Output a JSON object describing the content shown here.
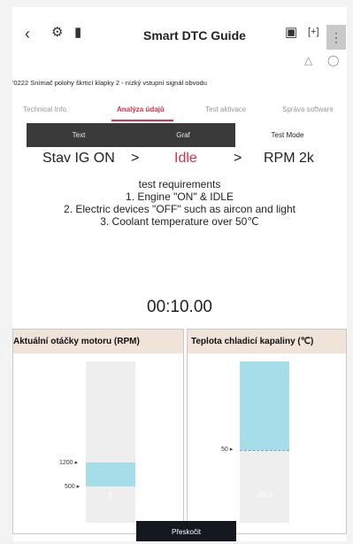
{
  "header": {
    "back_icon": "chevron-left-icon",
    "title": "Smart DTC Guide",
    "icons": [
      "car-settings-icon",
      "battery-icon",
      "camera-icon",
      "bracket-icon",
      "kebab-icon"
    ],
    "sub_icons": [
      "car-icon",
      "power-icon"
    ]
  },
  "dtc": {
    "title": "'0222 Snímač polohy škrticí klapky 2 - nízký vstupní signál obvodu"
  },
  "tabs": [
    "Technical Info.",
    "Analýza údajů",
    "Test aktivace",
    "Správa software"
  ],
  "tabs_active": "Analýza údajů",
  "segments": [
    "Text",
    "Graf",
    "Test Mode"
  ],
  "segments_active": "Test Mode",
  "flow": {
    "step1": "Stav IG ON",
    "arrow": ">",
    "step2": "Idle",
    "step3": "RPM 2k"
  },
  "requirements": {
    "heading": "test requirements",
    "lines": [
      "1. Engine \"ON\" & IDLE",
      "2. Electric devices \"OFF\" such as aircon and light",
      "3. Coolant temperature over 50℃"
    ]
  },
  "timer": "00:10.00",
  "gauges": [
    {
      "title": "Aktuální otáčky motoru (RPM)",
      "value": "0",
      "ticks": [
        "1200 ▸",
        "500 ▸"
      ],
      "fill_low": 500,
      "fill_high": 1200
    },
    {
      "title": "Teplota chladicí kapaliny (℃)",
      "value": "-39.0",
      "ticks": [
        "50 ▸"
      ],
      "threshold": 50
    }
  ],
  "skip_button": "Přeskočit",
  "colors": {
    "accent": "#d9304d",
    "fill": "#a5dde8",
    "dark": "#3a3a3a",
    "header_bg": "#efe4d7"
  }
}
